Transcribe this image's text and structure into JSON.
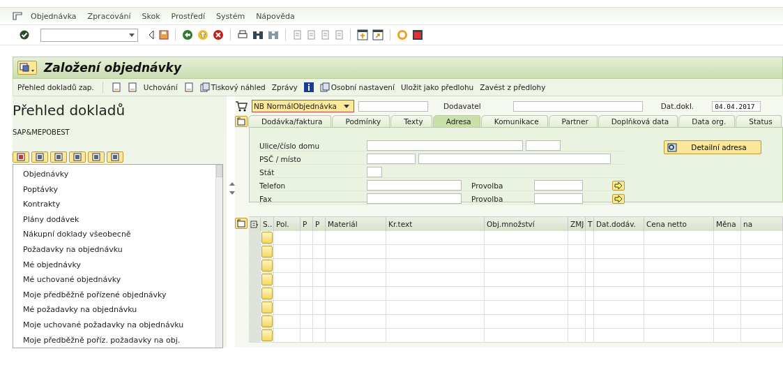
{
  "menu": [
    {
      "label": "Objednávka"
    },
    {
      "label": "Zpracování"
    },
    {
      "label": "Skok"
    },
    {
      "label": "Prostředí"
    },
    {
      "label": "Systém"
    },
    {
      "label": "Nápověda"
    }
  ],
  "window": {
    "title": "Založení objednávky"
  },
  "app_toolbar": [
    {
      "kind": "text",
      "label": "Přehled dokladů zap."
    },
    {
      "kind": "icon"
    },
    {
      "kind": "icon"
    },
    {
      "kind": "text",
      "label": "Uchování"
    },
    {
      "kind": "icon"
    },
    {
      "kind": "icon-text",
      "label": "Tiskový náhled"
    },
    {
      "kind": "text",
      "label": "Zprávy"
    },
    {
      "kind": "icon"
    },
    {
      "kind": "icon-text",
      "label": "Osobní nastavení"
    },
    {
      "kind": "text",
      "label": "Uložit jako předlohu"
    },
    {
      "kind": "text",
      "label": "Zavést z předlohy"
    }
  ],
  "sidebar": {
    "title": "Přehled dokladů",
    "subtitle": "SAP&MEPOBEST",
    "items": [
      "Objednávky",
      "Poptávky",
      "Kontrakty",
      "Plány dodávek",
      "Nákupní doklady všeobecně",
      "Požadavky na objednávku",
      "Mé objednávky",
      "Mé uchované objednávky",
      "Moje předběžně pořízené objednávky",
      "Mé požadavky na objednávku",
      "Moje uchované požadavky na objednávku",
      "Moje předběžně poříz. požadavky na obj."
    ]
  },
  "header": {
    "doc_type": "NB NormálObjednávka",
    "supplier_label": "Dodavatel",
    "date_label": "Dat.dokl.",
    "date_value": "04.04.2017"
  },
  "tabs": [
    {
      "label": "Dodávka/faktura",
      "selected": false
    },
    {
      "label": "Podmínky",
      "selected": false
    },
    {
      "label": "Texty",
      "selected": false
    },
    {
      "label": "Adresa",
      "selected": true
    },
    {
      "label": "Komunikace",
      "selected": false
    },
    {
      "label": "Partner",
      "selected": false
    },
    {
      "label": "Doplňková data",
      "selected": false
    },
    {
      "label": "Data org.",
      "selected": false
    },
    {
      "label": "Status",
      "selected": false
    }
  ],
  "address": {
    "street_label": "Ulice/číslo domu",
    "zip_label": "PSČ / místo",
    "country_label": "Stát",
    "phone_label": "Telefon",
    "fax_label": "Fax",
    "ext_label_1": "Provolba",
    "ext_label_2": "Provolba",
    "detail_button": "Detailní adresa"
  },
  "table": {
    "columns": [
      "S..",
      "Pol.",
      "P",
      "P",
      "Materiál",
      "Kr.text",
      "Obj.množství",
      "ZMJ",
      "T",
      "Dat.dodáv.",
      "Cena netto",
      "Měna",
      "na"
    ]
  }
}
